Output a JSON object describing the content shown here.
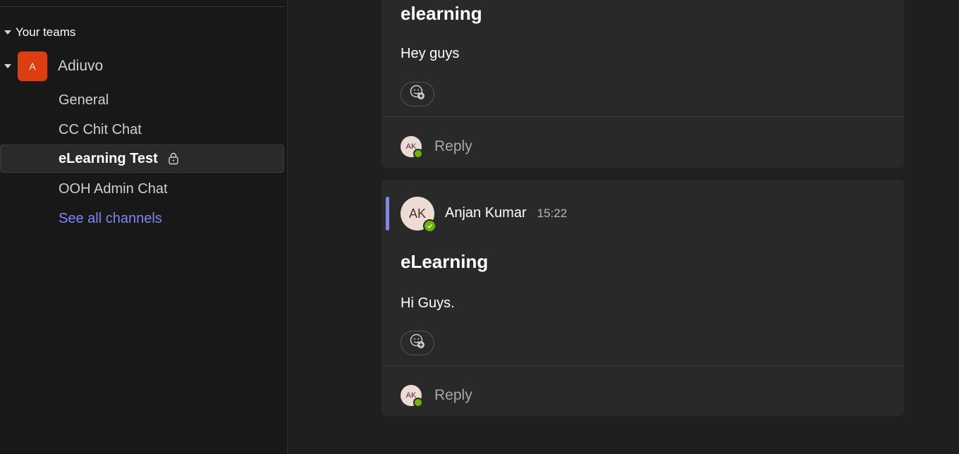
{
  "sidebar": {
    "section_label": "Your teams",
    "team": {
      "initial": "A",
      "name": "Adiuvo"
    },
    "channels": [
      {
        "label": "General"
      },
      {
        "label": "CC Chit Chat"
      },
      {
        "label": "eLearning Test"
      },
      {
        "label": "OOH Admin Chat"
      }
    ],
    "see_all_label": "See all channels"
  },
  "messages": [
    {
      "subject": "elearning",
      "body": "Hey guys",
      "reply_avatar": "AK",
      "reply_label": "Reply"
    },
    {
      "author_initials": "AK",
      "author": "Anjan Kumar",
      "time": "15:22",
      "subject": "eLearning",
      "body": "Hi Guys.",
      "reply_avatar": "AK",
      "reply_label": "Reply"
    }
  ],
  "colors": {
    "accent": "#7f85f5",
    "team_avatar": "#dc3e0f",
    "presence_available": "#6bb700"
  }
}
